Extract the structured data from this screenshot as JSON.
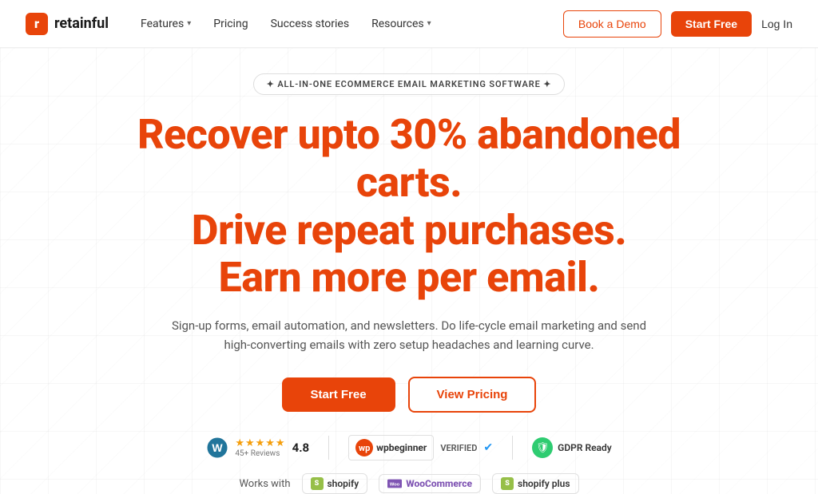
{
  "logo": {
    "icon_letter": "r",
    "text": "retainful"
  },
  "nav": {
    "features_label": "Features",
    "pricing_label": "Pricing",
    "success_stories_label": "Success stories",
    "resources_label": "Resources",
    "book_demo_label": "Book a Demo",
    "start_free_label": "Start Free",
    "login_label": "Log In"
  },
  "hero": {
    "badge_text": "✦  ALL-IN-ONE ECOMMERCE EMAIL MARKETING SOFTWARE  ✦",
    "headline_line1": "Recover upto 30% abandoned carts.",
    "headline_line2": "Drive repeat purchases.",
    "headline_line3": "Earn more per email.",
    "subtext": "Sign-up forms, email automation, and newsletters. Do life-cycle email marketing and send high-converting emails with zero setup headaches and learning curve.",
    "cta_start_free": "Start Free",
    "cta_view_pricing": "View Pricing",
    "rating_stars": "★★★★★",
    "rating_reviews": "45+ Reviews",
    "rating_score": "4.8",
    "wpb_label": "wpbeginner",
    "verified_label": "VERIFIED",
    "gdpr_label": "GDPR Ready",
    "works_with_label": "Works with",
    "platform_shopify": "shopify",
    "platform_woo": "WooCommerce",
    "platform_shopify_plus": "shopify plus"
  }
}
